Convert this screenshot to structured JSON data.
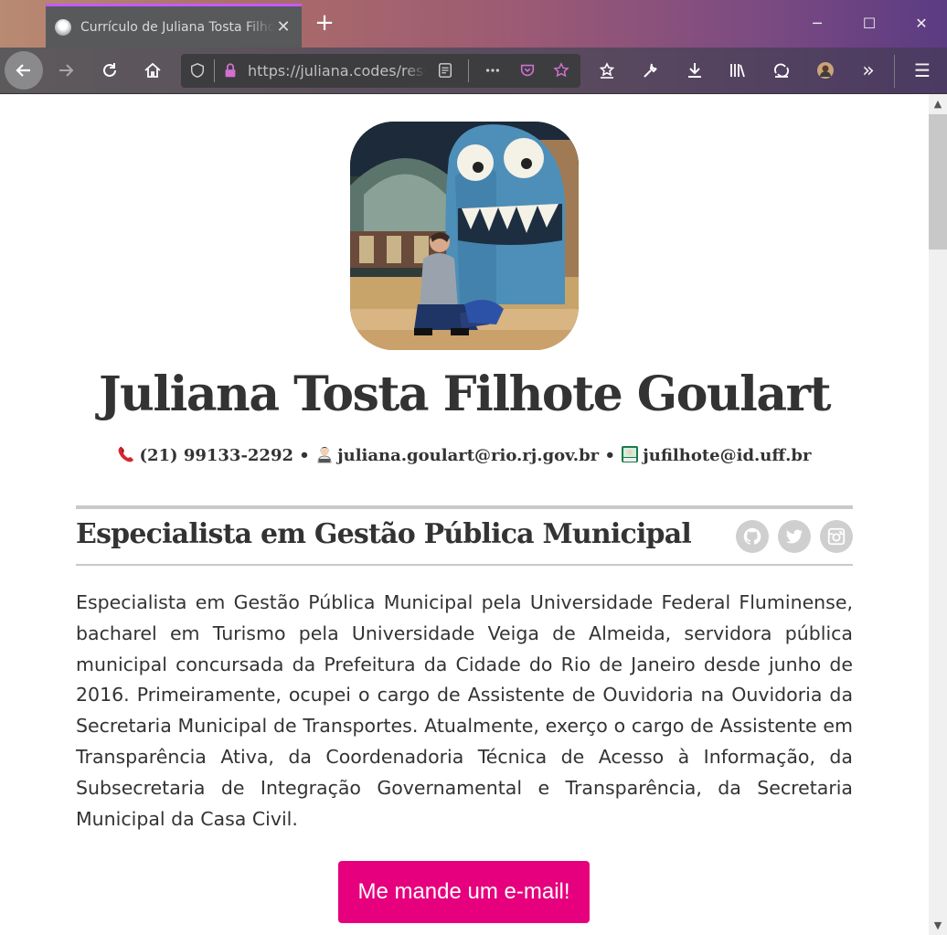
{
  "browser": {
    "tab_title": "Currículo de Juliana Tosta Filhote Goulart",
    "url": "https://juliana.codes/resume",
    "accent_color": "#c35cff"
  },
  "icons": {
    "back": "arrow-left-icon",
    "forward": "arrow-right-icon",
    "reload": "reload-icon",
    "home": "home-icon",
    "shield": "shield-icon",
    "lock": "lock-icon",
    "reader": "reader-view-icon",
    "more": "ellipsis-icon",
    "pocket": "pocket-icon",
    "bookmark": "star-icon",
    "win_minimize": "─",
    "win_maximize": "☐",
    "win_close": "✕",
    "new_tab": "+",
    "tab_close": "✕",
    "overflow": "»",
    "menu": "☰"
  },
  "profile": {
    "name": "Juliana Tosta Filhote Goulart",
    "phone": "(21) 99133-2292",
    "email_work": "juliana.goulart@rio.rj.gov.br",
    "email_uni": "jufilhote@id.uff.br",
    "separator": "•"
  },
  "section": {
    "title": "Especialista em Gestão Pública Municipal",
    "bio": "Especialista em Gestão Pública Municipal pela Universidade Federal Fluminense, bacharel em Turismo pela Universidade Veiga de Almeida, servidora pública municipal concursada da Prefeitura da Cidade do Rio de Janeiro desde junho de 2016. Primeiramente, ocupei o cargo de Assistente de Ouvidoria na Ouvidoria da Secretaria Municipal de Transportes. Atualmente, exerço o cargo de Assistente em Transparência Ativa, da Coordenadoria Técnica de Acesso à Informação, da Subsecretaria de Integração Governamental e Transparência, da Secretaria Municipal da Casa Civil."
  },
  "cta": {
    "label": "Me mande um e-mail!",
    "color": "#e6007e"
  }
}
